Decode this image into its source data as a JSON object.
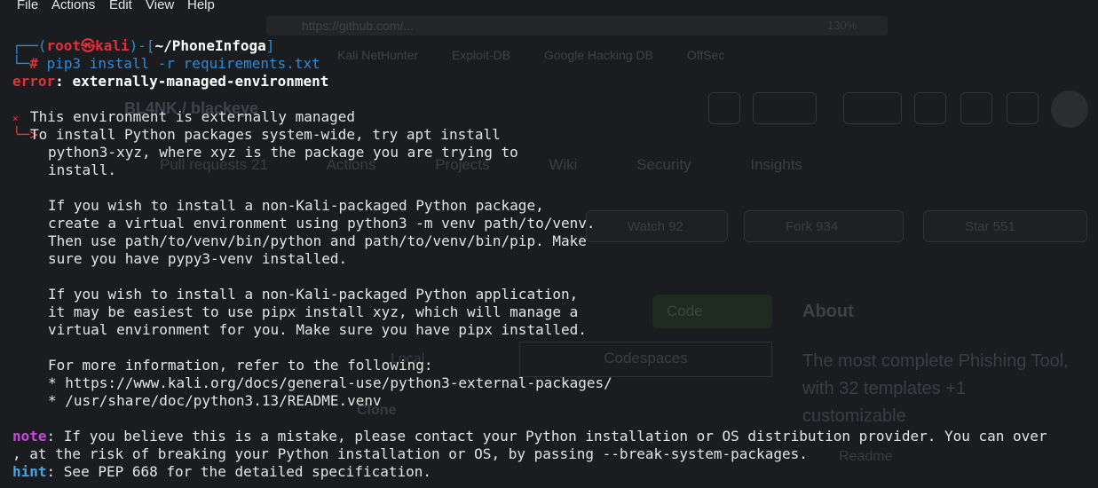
{
  "menu": [
    "File",
    "Actions",
    "Edit",
    "View",
    "Help"
  ],
  "background_browser": {
    "url": "https://github.com/...",
    "zoom": "130%",
    "bookmarks": [
      "Kali NetHunter",
      "Exploit-DB",
      "Google Hacking DB",
      "OffSec"
    ],
    "repo": "BL4NK / blackeye",
    "tabs": [
      "Pull requests 21",
      "Actions",
      "Projects",
      "Wiki",
      "Security",
      "Insights"
    ],
    "watch": "Watch 92",
    "fork": "Fork 934",
    "star": "Star 551",
    "code_button": "Code",
    "about_heading": "About",
    "about_text": "The most complete Phishing Tool, with 32 templates +1 customizable",
    "codespaces": "Codespaces",
    "local": "Local",
    "clone": "Clone",
    "readme": "Readme"
  },
  "terminal": {
    "prompt_user": "root",
    "prompt_host": "kali",
    "prompt_path": "~/PhoneInfoga",
    "command": "pip3 install -r requirements.txt",
    "error_label": "error",
    "error_text": ": externally-managed-environment",
    "managed_title": "This environment is externally managed",
    "body_lines": [
      "To install Python packages system-wide, try apt install",
      "python3-xyz, where xyz is the package you are trying to",
      "install.",
      "",
      "If you wish to install a non-Kali-packaged Python package,",
      "create a virtual environment using python3 -m venv path/to/venv.",
      "Then use path/to/venv/bin/python and path/to/venv/bin/pip. Make",
      "sure you have pypy3-venv installed.",
      "",
      "If you wish to install a non-Kali-packaged Python application,",
      "it may be easiest to use pipx install xyz, which will manage a",
      "virtual environment for you. Make sure you have pipx installed.",
      "",
      "For more information, refer to the following:",
      "* https://www.kali.org/docs/general-use/python3-external-packages/",
      "* /usr/share/doc/python3.13/README.venv"
    ],
    "note_label": "note",
    "note_text": ": If you believe this is a mistake, please contact your Python installation or OS distribution provider. You can over",
    "note_cont": ", at the risk of breaking your Python installation or OS, by passing --break-system-packages.",
    "hint_label": "hint",
    "hint_text": ": See PEP 668 for the detailed specification."
  }
}
